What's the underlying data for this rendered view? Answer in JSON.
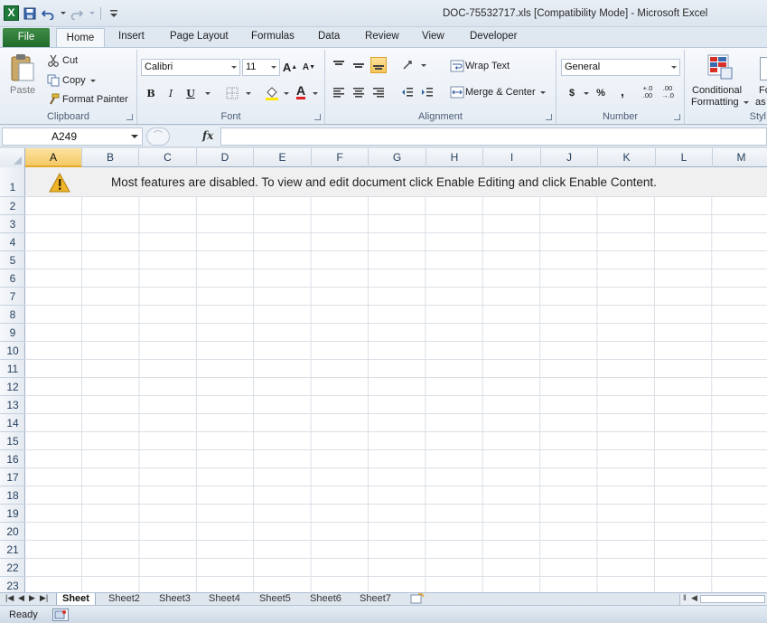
{
  "window": {
    "title": "DOC-75532717.xls  [Compatibility Mode]  -  Microsoft Excel"
  },
  "ribbon_tabs": [
    "File",
    "Home",
    "Insert",
    "Page Layout",
    "Formulas",
    "Data",
    "Review",
    "View",
    "Developer"
  ],
  "ribbon": {
    "clipboard": {
      "label": "Clipboard",
      "paste": "Paste",
      "cut": "Cut",
      "copy": "Copy",
      "format_painter": "Format Painter"
    },
    "font": {
      "label": "Font",
      "font_name": "Calibri",
      "font_size": "11",
      "bold": "B",
      "italic": "I",
      "underline": "U",
      "grow": "A",
      "shrink": "A"
    },
    "alignment": {
      "label": "Alignment",
      "wrap_text": "Wrap Text",
      "merge_center": "Merge & Center"
    },
    "number": {
      "label": "Number",
      "format": "General",
      "currency": "$",
      "percent": "%",
      "comma": ",",
      "inc_decimal": "+.0\n.00",
      "dec_decimal": ".00\n→.0"
    },
    "styles": {
      "conditional_line1": "Conditional",
      "conditional_line2": "Formatting",
      "format_as_line1": "Fo",
      "format_as_line2": "as T",
      "label": "Styl"
    }
  },
  "formula_bar": {
    "name_box": "A249",
    "fx": "fx",
    "value": ""
  },
  "grid": {
    "columns": [
      "A",
      "B",
      "C",
      "D",
      "E",
      "F",
      "G",
      "H",
      "I",
      "J",
      "K",
      "L",
      "M"
    ],
    "selected_column": "A",
    "rows": [
      "1",
      "2",
      "3",
      "4",
      "5",
      "6",
      "7",
      "8",
      "9",
      "10",
      "11",
      "12",
      "13",
      "14",
      "15",
      "16",
      "17",
      "18",
      "19",
      "20",
      "21",
      "22",
      "23"
    ],
    "banner_text": "Most features are disabled. To view and edit document click Enable Editing and click Enable Content."
  },
  "sheets": [
    "Sheet",
    "Sheet2",
    "Sheet3",
    "Sheet4",
    "Sheet5",
    "Sheet6",
    "Sheet7"
  ],
  "active_sheet": "Sheet",
  "status": {
    "text": "Ready"
  },
  "colors": {
    "file_tab": "#2a7a35",
    "selected_header": "#f5c865",
    "warning": "#f0b429"
  }
}
